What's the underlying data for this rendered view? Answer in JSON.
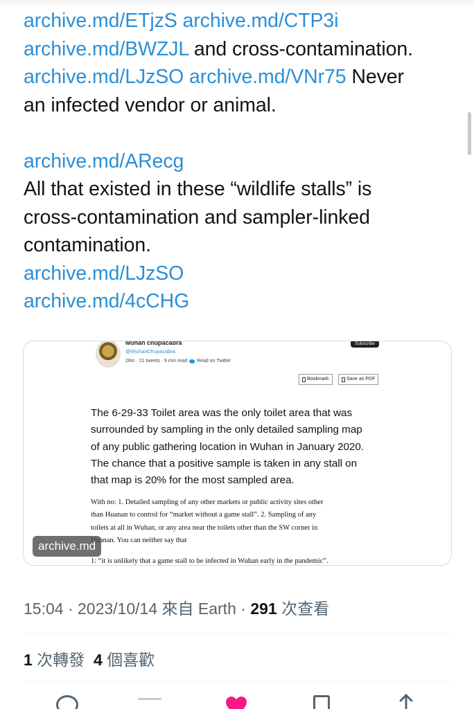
{
  "tweet": {
    "lines": [
      [
        {
          "t": "archive.md/ETjzS archive.md/CTP3i",
          "link": true
        }
      ],
      [
        {
          "t": "archive.md/BWZJL",
          "link": true
        },
        {
          "t": " and cross-contamination.",
          "link": false
        }
      ],
      [
        {
          "t": "archive.md/LJzSO archive.md/VNr75",
          "link": true
        },
        {
          "t": " Never",
          "link": false
        }
      ],
      [
        {
          "t": "an infected vendor or animal.",
          "link": false
        }
      ],
      [],
      [
        {
          "t": "archive.md/ARecg",
          "link": true
        }
      ],
      [
        {
          "t": "All that existed in these “wildlife stalls” is",
          "link": false
        }
      ],
      [
        {
          "t": "cross-contamination and sampler-linked",
          "link": false
        }
      ],
      [
        {
          "t": "contamination.",
          "link": false
        }
      ],
      [
        {
          "t": "archive.md/LJzSO",
          "link": true
        }
      ],
      [
        {
          "t": "archive.md/4cCHG",
          "link": true
        }
      ]
    ]
  },
  "card": {
    "author_name": "wuhan chupacabra",
    "author_handle": "@WuhanChupacabra",
    "author_meta": "28m · 21 tweets · 9 min read",
    "read_on": "Read on Twitter",
    "subscribe_label": "Subscribe",
    "bookmark_label": "Bookmark",
    "save_pdf_label": "Save as PDF",
    "body_lines": [
      "The 6-29-33 Toilet area was the only toilet area that was",
      "surrounded by sampling in the only detailed sampling map",
      "of any public gathering location in Wuhan in January 2020.",
      "The chance that a positive sample is taken in any stall on",
      "that map is 20% for the most sampled area."
    ],
    "serif_lines": [
      "With no: 1. Detailed sampling of any other markets or public activity sites other",
      "than Huanan to control for “market without a game stall”. 2. Sampling of any",
      "toilets at all in Wuhan, or any area near the toilets other than the SW corner in",
      "Huanan. You can neither say that"
    ],
    "serif_last": "1: “it is unlikely that a game stall to be infected in Wuhan early in the pandemic”.",
    "domain": "archive.md"
  },
  "meta": {
    "time": "15:04 · 2023/10/14 來自 Earth · ",
    "views_count": "291",
    "views_label": " 次查看"
  },
  "stats": {
    "retweets_count": "1",
    "retweets_label": " 次轉發",
    "likes_count": "4",
    "likes_label": " 個喜歡"
  },
  "colors": {
    "link": "#2b8fd6",
    "like": "#f91880",
    "muted": "#536471"
  },
  "icons": [
    "reply-icon",
    "retweet-icon",
    "like-icon",
    "bookmark-icon",
    "share-icon"
  ]
}
